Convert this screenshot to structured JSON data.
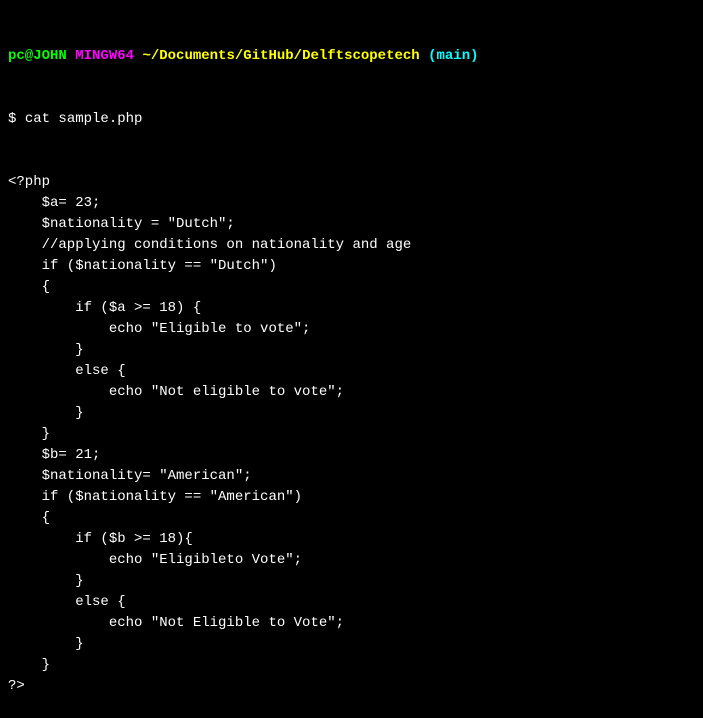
{
  "prompt": {
    "user_host": "pc@JOHN",
    "env": "MINGW64",
    "path": "~/Documents/GitHub/Delftscopetech",
    "branch": "(main)"
  },
  "command": {
    "symbol": "$",
    "text": "cat sample.php"
  },
  "code_lines": [
    "<?php",
    "    $a= 23;",
    "    $nationality = \"Dutch\";",
    "    //applying conditions on nationality and age",
    "    if ($nationality == \"Dutch\")",
    "    {",
    "        if ($a >= 18) {",
    "            echo \"Eligible to vote\";",
    "        }",
    "        else {",
    "            echo \"Not eligible to vote\";",
    "        }",
    "    }",
    "    $b= 21;",
    "    $nationality= \"American\";",
    "    if ($nationality == \"American\")",
    "    {",
    "        if ($b >= 18){",
    "            echo \"Eligibleto Vote\";",
    "        }",
    "        else {",
    "            echo \"Not Eligible to Vote\";",
    "        }",
    "    }",
    "?>"
  ]
}
